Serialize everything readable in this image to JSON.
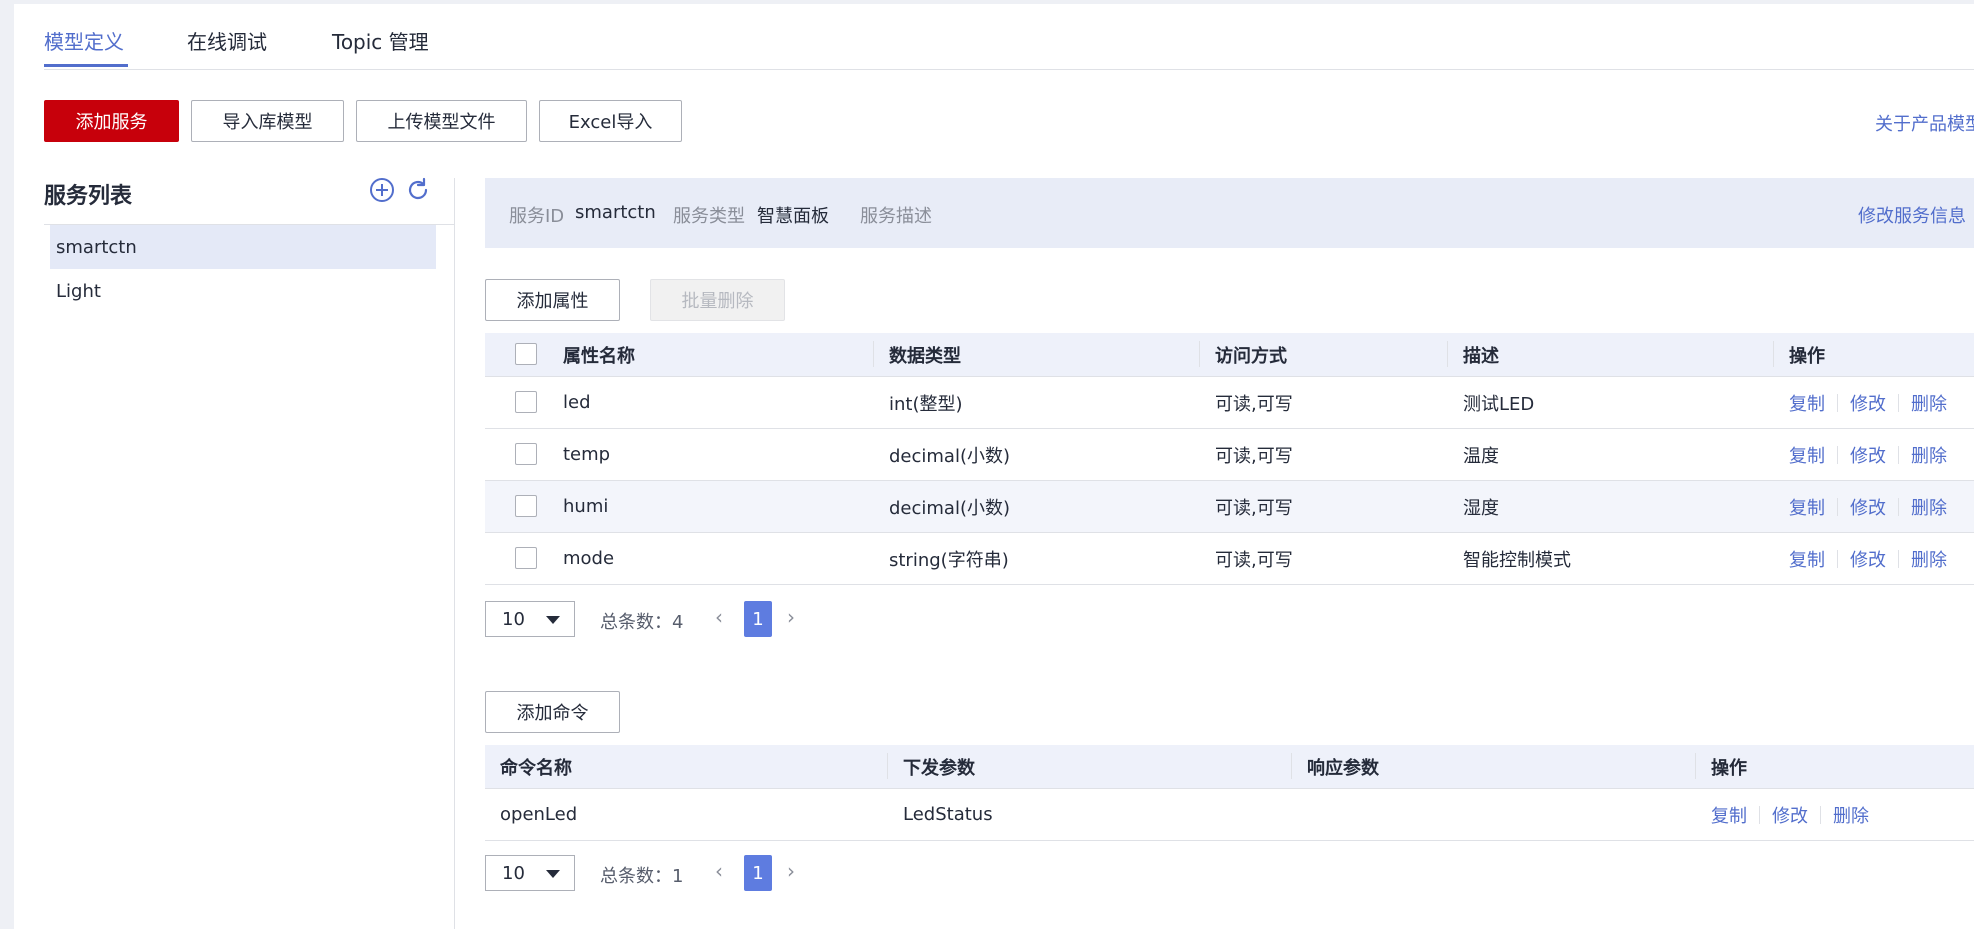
{
  "tabs": [
    {
      "label": "模型定义",
      "active": true
    },
    {
      "label": "在线调试",
      "active": false
    },
    {
      "label": "Topic 管理",
      "active": false
    }
  ],
  "toolbar": {
    "add_service": "添加服务",
    "import_library_model": "导入库模型",
    "upload_model_file": "上传模型文件",
    "excel_import": "Excel导入",
    "about_link": "关于产品模型"
  },
  "service_list": {
    "title": "服务列表",
    "add_icon": "plus-circle-icon",
    "refresh_icon": "refresh-icon",
    "items": [
      {
        "label": "smartctn",
        "selected": true
      },
      {
        "label": "Light",
        "selected": false
      }
    ]
  },
  "service_info": {
    "id_label": "服务ID",
    "id_value": "smartctn",
    "type_label": "服务类型",
    "type_value": "智慧面板",
    "desc_label": "服务描述",
    "desc_value": "",
    "edit_link": "修改服务信息"
  },
  "properties": {
    "add_button": "添加属性",
    "batch_delete_button": "批量删除",
    "headers": [
      "属性名称",
      "数据类型",
      "访问方式",
      "描述",
      "操作"
    ],
    "rows": [
      {
        "name": "led",
        "type": "int(整型)",
        "access": "可读,可写",
        "desc": "测试LED"
      },
      {
        "name": "temp",
        "type": "decimal(小数)",
        "access": "可读,可写",
        "desc": "温度"
      },
      {
        "name": "humi",
        "type": "decimal(小数)",
        "access": "可读,可写",
        "desc": "湿度"
      },
      {
        "name": "mode",
        "type": "string(字符串)",
        "access": "可读,可写",
        "desc": "智能控制模式"
      }
    ],
    "ops": [
      "复制",
      "修改",
      "删除"
    ],
    "pagination": {
      "page_size": "10",
      "total": "总条数：4",
      "current_page": "1"
    }
  },
  "commands": {
    "add_button": "添加命令",
    "headers": [
      "命令名称",
      "下发参数",
      "响应参数",
      "操作"
    ],
    "rows": [
      {
        "name": "openLed",
        "params": "LedStatus",
        "response": ""
      }
    ],
    "ops": [
      "复制",
      "修改",
      "删除"
    ],
    "pagination": {
      "page_size": "10",
      "total": "总条数：1",
      "current_page": "1"
    }
  },
  "colors": {
    "primary": "#c7000b",
    "accent": "#526ecc",
    "pager": "#5e7ce0"
  }
}
